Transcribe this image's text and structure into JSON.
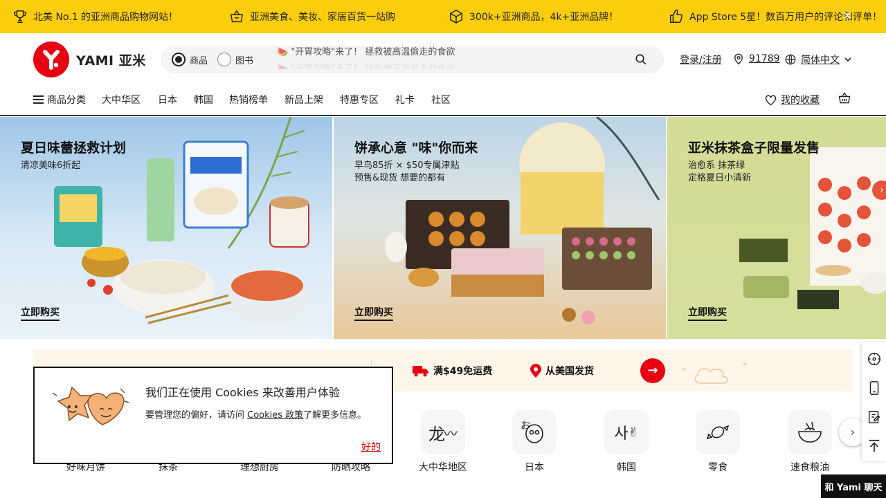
{
  "topbar": {
    "items": [
      {
        "icon": "trophy-icon",
        "text": "北美 No.1 的亚洲商品购物网站！"
      },
      {
        "icon": "basket-icon",
        "text": "亚洲美食、美妆、家居百货一站购"
      },
      {
        "icon": "box-icon",
        "text": "300k+亚洲商品，4k+亚洲品牌！"
      },
      {
        "icon": "thumbs-up-icon",
        "text": "App Store 5星！数百万用户的评论和评单！"
      }
    ],
    "close_label": "✕"
  },
  "header": {
    "logo_text": "YAMI 亚米",
    "search": {
      "option_products": "商品",
      "option_books": "图书",
      "selected": "商品",
      "placeholder": "🍉 \"开胃攻略\"来了！ 拯救被高温偷走的食欲",
      "placeholder_ghost": "🍉 \"开胃攻略\"来了！ 拯救被高温偷走的食欲"
    },
    "login_label": "登录/注册",
    "zip_code": "91789",
    "language_label": "简体中文"
  },
  "nav": {
    "items": [
      "商品分类",
      "大中华区",
      "日本",
      "韩国",
      "热销榜单",
      "新品上架",
      "特惠专区",
      "礼卡",
      "社区"
    ],
    "favorites_label": "我的收藏"
  },
  "banners": [
    {
      "title": "夏日味蕾拯救计划",
      "sub": [
        "清凉美味6折起"
      ],
      "cta": "立即购买"
    },
    {
      "title": "饼承心意 \"味\"你而来",
      "sub": [
        "早鸟85折 × $50专属津贴",
        "预售&现货 想要的都有"
      ],
      "cta": "立即购买"
    },
    {
      "title": "亚米抹茶盒子限量发售",
      "sub": [
        "治愈系 抹茶绿",
        "定格夏日小清新"
      ],
      "cta": "立即购买"
    }
  ],
  "promo": {
    "free_shipping": "满$49免运费",
    "ship_from": "从美国发货"
  },
  "categories": [
    {
      "label": "好味月饼"
    },
    {
      "label": "抹茶"
    },
    {
      "label": "理想厨房"
    },
    {
      "label": "防晒攻略"
    },
    {
      "label": "大中华地区",
      "icon_text": "龙"
    },
    {
      "label": "日本",
      "icon_text": "お"
    },
    {
      "label": "韩国",
      "icon_text": "사"
    },
    {
      "label": "零食"
    },
    {
      "label": "速食粮油"
    }
  ],
  "cookie": {
    "title": "我们正在使用 Cookies 来改善用户体验",
    "body_prefix": "要管理您的偏好，请访问 ",
    "link_text": "Cookies 政策",
    "body_suffix": "了解更多信息。",
    "ok_label": "好的"
  },
  "chat_label": "和 Yami 聊天",
  "colors": {
    "brand_red": "#e60012",
    "topbar_yellow": "#fccd0a"
  }
}
